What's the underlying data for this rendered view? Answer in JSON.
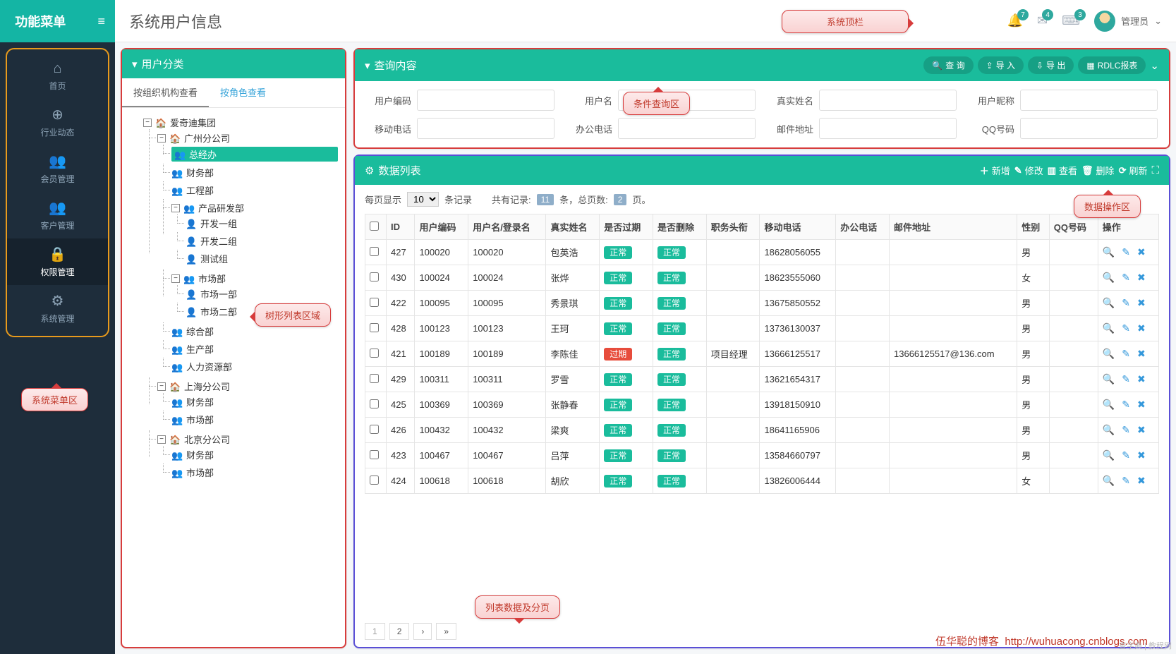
{
  "sidebar": {
    "title": "功能菜单",
    "menu": [
      {
        "icon": "⌂",
        "label": "首页"
      },
      {
        "icon": "⊕",
        "label": "行业动态"
      },
      {
        "icon": "👥",
        "label": "会员管理"
      },
      {
        "icon": "👥",
        "label": "客户管理"
      },
      {
        "icon": "🔒",
        "label": "权限管理"
      },
      {
        "icon": "⚙",
        "label": "系统管理"
      }
    ]
  },
  "header": {
    "title": "系统用户信息",
    "badges": [
      "7",
      "4",
      "3"
    ],
    "user": "管理员"
  },
  "treePanel": {
    "title": "用户分类",
    "tabs": [
      "按组织机构查看",
      "按角色查看"
    ],
    "root": "爱奇迪集团",
    "guangzhou": "广州分公司",
    "gz_depts": [
      "总经办",
      "财务部",
      "工程部"
    ],
    "rd": "产品研发部",
    "rd_teams": [
      "开发一组",
      "开发二组",
      "测试组"
    ],
    "market": "市场部",
    "market_sub": [
      "市场一部",
      "市场二部"
    ],
    "gz_depts2": [
      "综合部",
      "生产部",
      "人力资源部"
    ],
    "shanghai": "上海分公司",
    "sh_depts": [
      "财务部",
      "市场部"
    ],
    "beijing": "北京分公司",
    "bj_depts": [
      "财务部",
      "市场部"
    ]
  },
  "query": {
    "title": "查询内容",
    "buttons": {
      "search": "查 询",
      "import": "导 入",
      "export": "导 出",
      "report": "RDLC报表"
    },
    "labels": {
      "userCode": "用户编码",
      "userName": "用户名",
      "realName": "真实姓名",
      "nickName": "用户昵称",
      "mobile": "移动电话",
      "officePhone": "办公电话",
      "email": "邮件地址",
      "qq": "QQ号码"
    }
  },
  "dataPanel": {
    "title": "数据列表",
    "actions": {
      "add": "新增",
      "edit": "修改",
      "view": "查看",
      "delete": "删除",
      "refresh": "刷新"
    },
    "pager": {
      "perPageLabel": "每页显示",
      "perPageValue": "10",
      "perPageSuffix": "条记录",
      "totalPrefix": "共有记录:",
      "totalCount": "11",
      "totalMid": "条，总页数:",
      "pageCount": "2",
      "totalSuffix": "页。"
    },
    "columns": [
      "ID",
      "用户编码",
      "用户名/登录名",
      "真实姓名",
      "是否过期",
      "是否删除",
      "职务头衔",
      "移动电话",
      "办公电话",
      "邮件地址",
      "性别",
      "QQ号码",
      "操作"
    ],
    "status_ok": "正常",
    "status_expired": "过期",
    "rows": [
      {
        "id": "427",
        "code": "100020",
        "login": "100020",
        "name": "包英浩",
        "expired": false,
        "deleted": false,
        "title": "",
        "mobile": "18628056055",
        "office": "",
        "email": "",
        "gender": "男",
        "qq": ""
      },
      {
        "id": "430",
        "code": "100024",
        "login": "100024",
        "name": "张烨",
        "expired": false,
        "deleted": false,
        "title": "",
        "mobile": "18623555060",
        "office": "",
        "email": "",
        "gender": "女",
        "qq": ""
      },
      {
        "id": "422",
        "code": "100095",
        "login": "100095",
        "name": "秀景琪",
        "expired": false,
        "deleted": false,
        "title": "",
        "mobile": "13675850552",
        "office": "",
        "email": "",
        "gender": "男",
        "qq": ""
      },
      {
        "id": "428",
        "code": "100123",
        "login": "100123",
        "name": "王珂",
        "expired": false,
        "deleted": false,
        "title": "",
        "mobile": "13736130037",
        "office": "",
        "email": "",
        "gender": "男",
        "qq": ""
      },
      {
        "id": "421",
        "code": "100189",
        "login": "100189",
        "name": "李陈佳",
        "expired": true,
        "deleted": false,
        "title": "项目经理",
        "mobile": "13666125517",
        "office": "",
        "email": "13666125517@136.com",
        "gender": "男",
        "qq": ""
      },
      {
        "id": "429",
        "code": "100311",
        "login": "100311",
        "name": "罗雪",
        "expired": false,
        "deleted": false,
        "title": "",
        "mobile": "13621654317",
        "office": "",
        "email": "",
        "gender": "男",
        "qq": ""
      },
      {
        "id": "425",
        "code": "100369",
        "login": "100369",
        "name": "张静春",
        "expired": false,
        "deleted": false,
        "title": "",
        "mobile": "13918150910",
        "office": "",
        "email": "",
        "gender": "男",
        "qq": ""
      },
      {
        "id": "426",
        "code": "100432",
        "login": "100432",
        "name": "梁爽",
        "expired": false,
        "deleted": false,
        "title": "",
        "mobile": "18641165906",
        "office": "",
        "email": "",
        "gender": "男",
        "qq": ""
      },
      {
        "id": "423",
        "code": "100467",
        "login": "100467",
        "name": "吕萍",
        "expired": false,
        "deleted": false,
        "title": "",
        "mobile": "13584660797",
        "office": "",
        "email": "",
        "gender": "男",
        "qq": ""
      },
      {
        "id": "424",
        "code": "100618",
        "login": "100618",
        "name": "胡欣",
        "expired": false,
        "deleted": false,
        "title": "",
        "mobile": "13826006444",
        "office": "",
        "email": "",
        "gender": "女",
        "qq": ""
      }
    ]
  },
  "callouts": {
    "topbar": "系统顶栏",
    "sidemenu": "系统菜单区",
    "tree": "树形列表区域",
    "query": "条件查询区",
    "dataOps": "数据操作区",
    "tableArea": "列表数据及分页"
  },
  "footer": {
    "text": "伍华聪的博客",
    "url": "http://wuhuacong.cnblogs.com"
  },
  "watermark": "查字典 | 教程网"
}
